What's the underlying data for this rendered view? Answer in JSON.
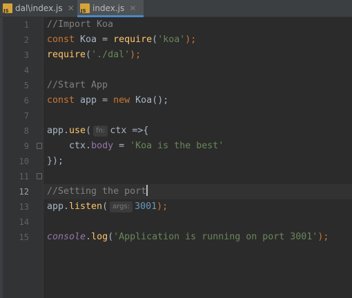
{
  "tabs": [
    {
      "label": "dal\\index.js",
      "close": "✕"
    },
    {
      "label": "index.js",
      "close": "✕"
    }
  ],
  "lines": [
    {
      "no": "1",
      "text": "//Import Koa"
    },
    {
      "no": "2",
      "kw": "const",
      "name": "Koa",
      "eq": "=",
      "fn": "require",
      "open": "(",
      "str": "'koa'",
      "close": ");"
    },
    {
      "no": "3",
      "fn": "require",
      "open": "(",
      "str": "'./dal'",
      "close": ");"
    },
    {
      "no": "4"
    },
    {
      "no": "5",
      "text": "//Start App"
    },
    {
      "no": "6",
      "kw": "const",
      "name": "app",
      "eq": "=",
      "kw2": "new",
      "call": "Koa();"
    },
    {
      "no": "7"
    },
    {
      "no": "8",
      "obj": "app.",
      "fn": "use",
      "open": "(",
      "hint": "fn:",
      "param": "ctx =>{"
    },
    {
      "no": "9",
      "obj": "ctx.",
      "prop": "body",
      "eq": "=",
      "str": "'Koa is the best'"
    },
    {
      "no": "10",
      "close": "});"
    },
    {
      "no": "11"
    },
    {
      "no": "12",
      "text": "//Setting the port"
    },
    {
      "no": "13",
      "obj": "app.",
      "fn": "listen",
      "open": "(",
      "hint": "args:",
      "num": "3001",
      "close": ");"
    },
    {
      "no": "14"
    },
    {
      "no": "15",
      "glob": "console",
      "dot": ".",
      "fn": "log",
      "open": "(",
      "str": "'Application is running on port 3001'",
      "close": ");"
    }
  ],
  "active_line": "12",
  "colors": {
    "background": "#2b2b2b",
    "keyword": "#cc7832",
    "function": "#ffc66d",
    "string": "#6a8759",
    "comment": "#808080",
    "property": "#9876aa",
    "number": "#6897bb"
  }
}
